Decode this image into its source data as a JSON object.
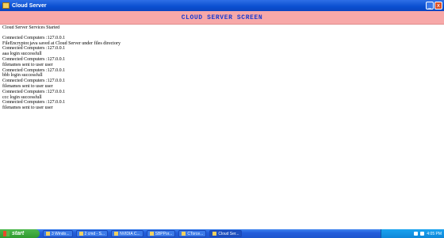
{
  "window": {
    "title": "Cloud Server",
    "minimize_glyph": "_",
    "close_glyph": "x"
  },
  "header": {
    "title": "CLOUD SERVER SCREEN",
    "background": "#f7a8a8",
    "title_color": "#1a3ad0"
  },
  "log": {
    "lines": [
      "Cloud Server Services Started",
      "Connected Computers :127.0.0.1",
      "FileEncryptor.java saved at Cloud Server under files directory",
      "Connected Computers :127.0.0.1",
      "aaa login successfull",
      "Connected Computers :127.0.0.1",
      "filenames sent to user user",
      "Connected Computers :127.0.0.1",
      "bbb login successfull",
      "Connected Computers :127.0.0.1",
      "filenames sent to user user",
      "Connected Computers :127.0.0.1",
      "ccc login successfull",
      "Connected Computers :127.0.0.1",
      "filenames sent to user user"
    ]
  },
  "taskbar": {
    "start_label": "start",
    "items": [
      "3 Windo...",
      "2 cmd - S...",
      "NVIDIA C...",
      "SBPPor...",
      "CTorce...",
      "Cloud Ser..."
    ],
    "tray_label": "4:05 PM"
  }
}
